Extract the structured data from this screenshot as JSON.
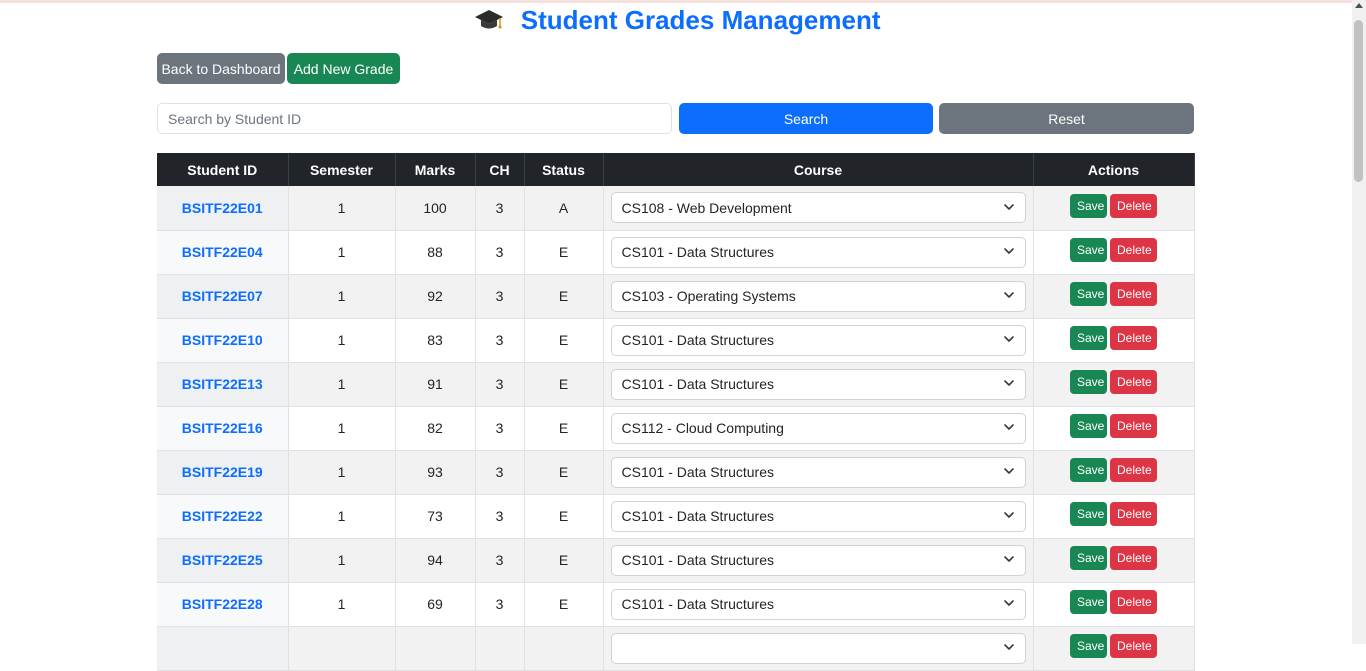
{
  "page": {
    "title": "Student Grades Management",
    "title_icon": "graduation-cap-icon"
  },
  "toolbar": {
    "back_label": "Back to Dashboard",
    "add_label": "Add New Grade"
  },
  "search": {
    "placeholder": "Search by Student ID",
    "value": "",
    "search_label": "Search",
    "reset_label": "Reset"
  },
  "table": {
    "headers": [
      "Student ID",
      "Semester",
      "Marks",
      "CH",
      "Status",
      "Course",
      "Actions"
    ],
    "save_label": "Save",
    "delete_label": "Delete",
    "rows": [
      {
        "id": "BSITF22E01",
        "semester": "1",
        "marks": "100",
        "ch": "3",
        "status": "A",
        "course": "CS108 - Web Development"
      },
      {
        "id": "BSITF22E04",
        "semester": "1",
        "marks": "88",
        "ch": "3",
        "status": "E",
        "course": "CS101 - Data Structures"
      },
      {
        "id": "BSITF22E07",
        "semester": "1",
        "marks": "92",
        "ch": "3",
        "status": "E",
        "course": "CS103 - Operating Systems"
      },
      {
        "id": "BSITF22E10",
        "semester": "1",
        "marks": "83",
        "ch": "3",
        "status": "E",
        "course": "CS101 - Data Structures"
      },
      {
        "id": "BSITF22E13",
        "semester": "1",
        "marks": "91",
        "ch": "3",
        "status": "E",
        "course": "CS101 - Data Structures"
      },
      {
        "id": "BSITF22E16",
        "semester": "1",
        "marks": "82",
        "ch": "3",
        "status": "E",
        "course": "CS112 - Cloud Computing"
      },
      {
        "id": "BSITF22E19",
        "semester": "1",
        "marks": "93",
        "ch": "3",
        "status": "E",
        "course": "CS101 - Data Structures"
      },
      {
        "id": "BSITF22E22",
        "semester": "1",
        "marks": "73",
        "ch": "3",
        "status": "E",
        "course": "CS101 - Data Structures"
      },
      {
        "id": "BSITF22E25",
        "semester": "1",
        "marks": "94",
        "ch": "3",
        "status": "E",
        "course": "CS101 - Data Structures"
      },
      {
        "id": "BSITF22E28",
        "semester": "1",
        "marks": "69",
        "ch": "3",
        "status": "E",
        "course": "CS101 - Data Structures"
      },
      {
        "id": "",
        "semester": "",
        "marks": "",
        "ch": "",
        "status": "",
        "course": ""
      }
    ]
  },
  "colors": {
    "primary": "#0d6efd",
    "success": "#198754",
    "danger": "#dc3545",
    "secondary": "#6c757d",
    "header_dark": "#212529"
  }
}
